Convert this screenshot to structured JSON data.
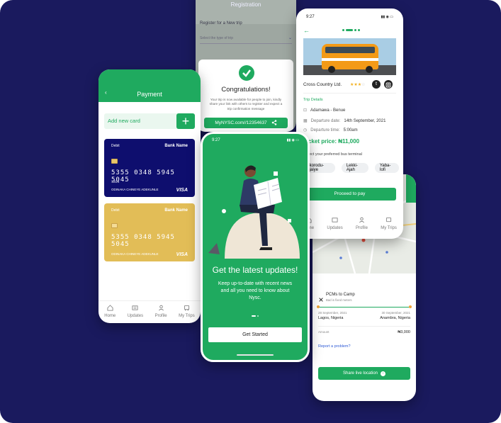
{
  "colors": {
    "accent": "#1faa5f",
    "background": "#1a1a5e",
    "card_dark": "#0e0e6e",
    "card_gold": "#e2bd57"
  },
  "tabs": [
    "Home",
    "Updates",
    "Profile",
    "My Trips"
  ],
  "registration": {
    "title": "Registration",
    "label": "Register for a New trip",
    "placeholder": "Select the type of trip",
    "dialog_title": "Congratulations!",
    "dialog_text": "Your trip is now available for people to join, kindly share your link with others to register and expect a trip confirmation message",
    "link": "MyNYSC.com//12354637"
  },
  "payment": {
    "title": "Payment",
    "add_card": "Add new card",
    "card1": {
      "type": "Debit",
      "bank": "Bank Name",
      "number": "5355  0348  5945  5045",
      "expiry": "12/24",
      "holder": "ODINAKA CHINEYE ADEKUNLE",
      "brand": "VISA"
    },
    "card2": {
      "type": "Debit",
      "bank": "Bank Name",
      "number": "5355  0348  5945  5045",
      "holder": "ODINAKA CHINEYE ADEKUNLE",
      "brand": "VISA"
    }
  },
  "onboarding": {
    "time": "9:27",
    "heading": "Get the latest updates!",
    "body": "Keep up-to-date with recent news and all you need to know about Nysc.",
    "button": "Get Started"
  },
  "trip": {
    "time": "9:27",
    "company": "Cross Country Ltd.",
    "section": "Trip Details",
    "route": "Adamawa - Benue",
    "departure_date_label": "Departure date:",
    "departure_date": "14th September, 2021",
    "departure_time_label": "Departure time:",
    "departure_time": "5:00am",
    "price_prefix": "Ticket price:",
    "price": "₦11,000",
    "terminal_prompt": "Select your preferred bus terminal",
    "terminals": [
      "Ikorodu-Ijaiye",
      "Lekki-Ajah",
      "Yaba-Iofi"
    ],
    "button": "Proceed to pay"
  },
  "map": {
    "route_title": "PCMs to Camp",
    "route_sub": "Bad is fixed meters",
    "from_date": "28 September, 2021",
    "from_place": "Lagos, Nigeria",
    "to_date": "30 September, 2021",
    "to_place": "Anambra, Nigeria",
    "amount_label": "Amount",
    "amount": "₦3,000",
    "report": "Report a problem?",
    "button": "Share live location"
  }
}
